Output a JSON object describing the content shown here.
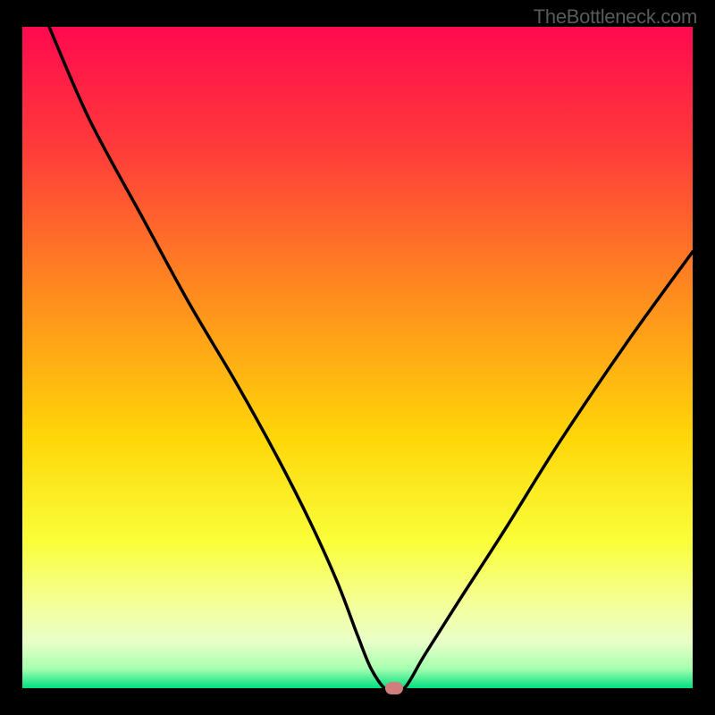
{
  "watermark": "TheBottleneck.com",
  "chart_data": {
    "type": "line",
    "title": "",
    "xlabel": "",
    "ylabel": "",
    "xlim": [
      0,
      100
    ],
    "ylim": [
      0,
      100
    ],
    "series": [
      {
        "name": "bottleneck-curve",
        "x": [
          4,
          10,
          18,
          25,
          32,
          38,
          43,
          47,
          50,
          52,
          54,
          55,
          57,
          60,
          65,
          72,
          80,
          90,
          100
        ],
        "y": [
          100,
          86,
          71,
          58,
          46,
          35,
          25,
          16,
          8,
          3,
          0,
          0,
          0,
          5,
          13,
          24,
          37,
          52,
          66
        ]
      }
    ],
    "optimal_point": {
      "x": 55.5,
      "y": 0
    },
    "background": {
      "type": "vertical-gradient",
      "stops": [
        {
          "pos": 0.0,
          "color": "#ff0a4f"
        },
        {
          "pos": 0.18,
          "color": "#ff3a3a"
        },
        {
          "pos": 0.4,
          "color": "#ff8a1f"
        },
        {
          "pos": 0.62,
          "color": "#ffd608"
        },
        {
          "pos": 0.78,
          "color": "#f9ff3a"
        },
        {
          "pos": 0.88,
          "color": "#f4ffa0"
        },
        {
          "pos": 0.93,
          "color": "#e8ffc8"
        },
        {
          "pos": 0.97,
          "color": "#a8ffb0"
        },
        {
          "pos": 1.0,
          "color": "#00e080"
        }
      ]
    }
  }
}
